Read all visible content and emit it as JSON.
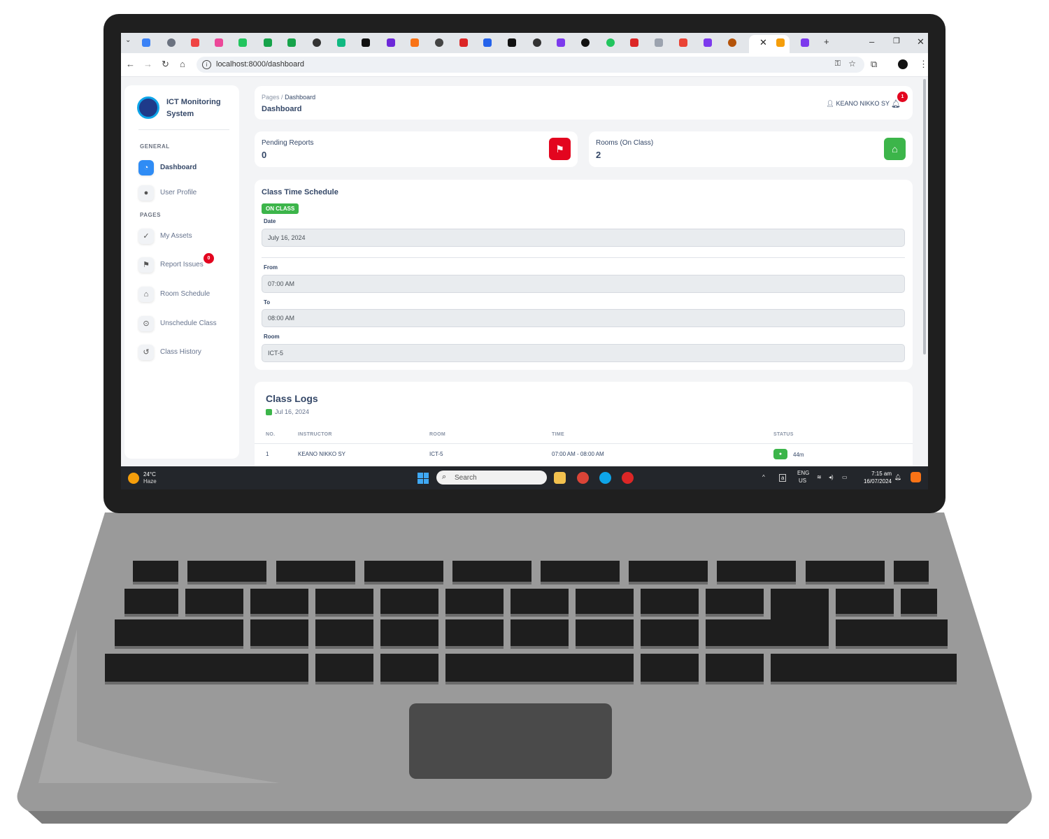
{
  "browser": {
    "url": "localhost:8000/dashboard"
  },
  "app": {
    "brand": "ICT Monitoring System",
    "sidebar": {
      "section_general": "GENERAL",
      "section_pages": "PAGES",
      "items": [
        {
          "label": "Dashboard",
          "icon": "dashboard-icon"
        },
        {
          "label": "User Profile",
          "icon": "user-icon"
        },
        {
          "label": "My Assets",
          "icon": "user-check-icon"
        },
        {
          "label": "Report Issues",
          "icon": "flag-icon",
          "badge": "0"
        },
        {
          "label": "Room Schedule",
          "icon": "house-icon"
        },
        {
          "label": "Unschedule Class",
          "icon": "car-clock-icon"
        },
        {
          "label": "Class History",
          "icon": "history-icon"
        }
      ]
    },
    "header": {
      "breadcrumb_root": "Pages",
      "breadcrumb_sep": "/",
      "breadcrumb_current": "Dashboard",
      "title": "Dashboard",
      "user_name": "KEANO NIKKO SY",
      "notifications": "1"
    },
    "stats": [
      {
        "label": "Pending Reports",
        "value": "0",
        "icon": "flag-icon",
        "color": "#e3051f"
      },
      {
        "label": "Rooms (On Class)",
        "value": "2",
        "icon": "house-icon",
        "color": "#3cb54a"
      }
    ],
    "schedule": {
      "title": "Class Time Schedule",
      "status": "ON CLASS",
      "date_label": "Date",
      "date_value": "July 16, 2024",
      "from_label": "From",
      "from_value": "07:00 AM",
      "to_label": "To",
      "to_value": "08:00 AM",
      "room_label": "Room",
      "room_value": "ICT-5"
    },
    "logs": {
      "title": "Class Logs",
      "date": "Jul 16, 2024",
      "columns": [
        "NO.",
        "INSTRUCTOR",
        "ROOM",
        "TIME",
        "STATUS"
      ],
      "rows": [
        {
          "no": "1",
          "instructor": "KEANO NIKKO SY",
          "room": "ICT-5",
          "time": "07:00 AM - 08:00 AM",
          "status": "44m"
        }
      ]
    }
  },
  "taskbar": {
    "weather_temp": "24°C",
    "weather_desc": "Haze",
    "search_placeholder": "Search",
    "lang_top": "ENG",
    "lang_bottom": "US",
    "time": "7:15 am",
    "date": "16/07/2024"
  }
}
